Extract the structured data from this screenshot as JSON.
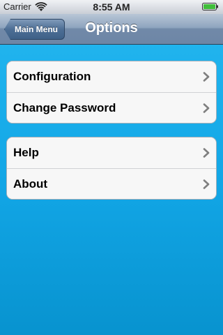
{
  "status_bar": {
    "carrier": "Carrier",
    "time": "8:55 AM",
    "icons": [
      "wifi-icon",
      "battery-icon"
    ]
  },
  "nav_bar": {
    "back_label": "Main Menu",
    "title": "Options"
  },
  "groups": [
    {
      "items": [
        {
          "label": "Configuration",
          "accessory": "chevron-right-icon"
        },
        {
          "label": "Change Password",
          "accessory": "chevron-right-icon"
        }
      ]
    },
    {
      "items": [
        {
          "label": "Help",
          "accessory": "chevron-right-icon"
        },
        {
          "label": "About",
          "accessory": "chevron-right-icon"
        }
      ]
    }
  ],
  "colors": {
    "background": "#12a6e6",
    "nav_bar": "#7189a8",
    "cell_background": "#f7f7f7",
    "chevron": "#7f7f7f"
  }
}
